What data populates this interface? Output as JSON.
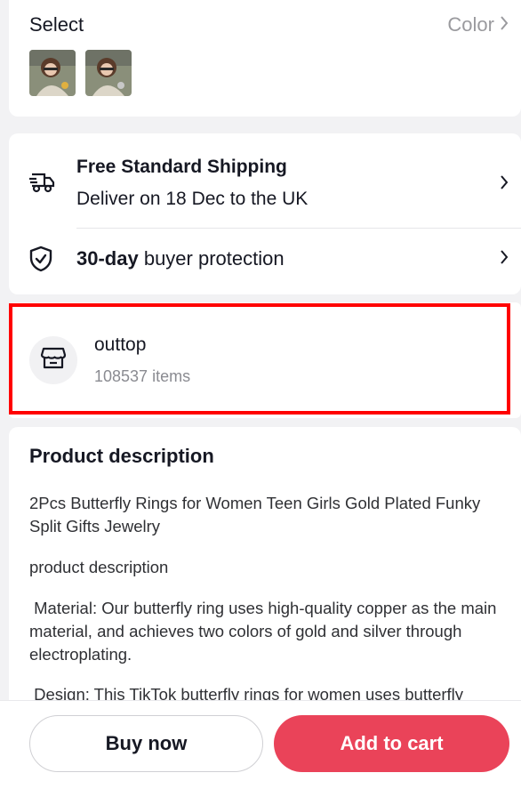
{
  "select": {
    "title": "Select",
    "color_label": "Color",
    "chevron": "›"
  },
  "shipping": {
    "title": "Free Standard Shipping",
    "subtitle": "Deliver on 18 Dec to the UK",
    "icon": "delivery-truck-icon"
  },
  "protection": {
    "bold": "30-day",
    "rest": " buyer protection",
    "icon": "shield-check-icon"
  },
  "shop": {
    "name": "outtop",
    "items": "108537 items",
    "icon": "store-icon"
  },
  "description": {
    "title": "Product description",
    "paragraphs": [
      "2Pcs Butterfly Rings for Women Teen Girls Gold Plated Funky Split Gifts Jewelry",
      "product description",
      " Material: Our butterfly ring uses high-quality copper as the main material, and achieves two colors of gold and silver through electroplating.",
      " Design: This TikTok butterfly rings for women uses butterfly"
    ]
  },
  "actions": {
    "buy_now": "Buy now",
    "add_to_cart": "Add to cart"
  },
  "colors": {
    "accent": "#ea4359",
    "highlight": "#ff0000"
  }
}
